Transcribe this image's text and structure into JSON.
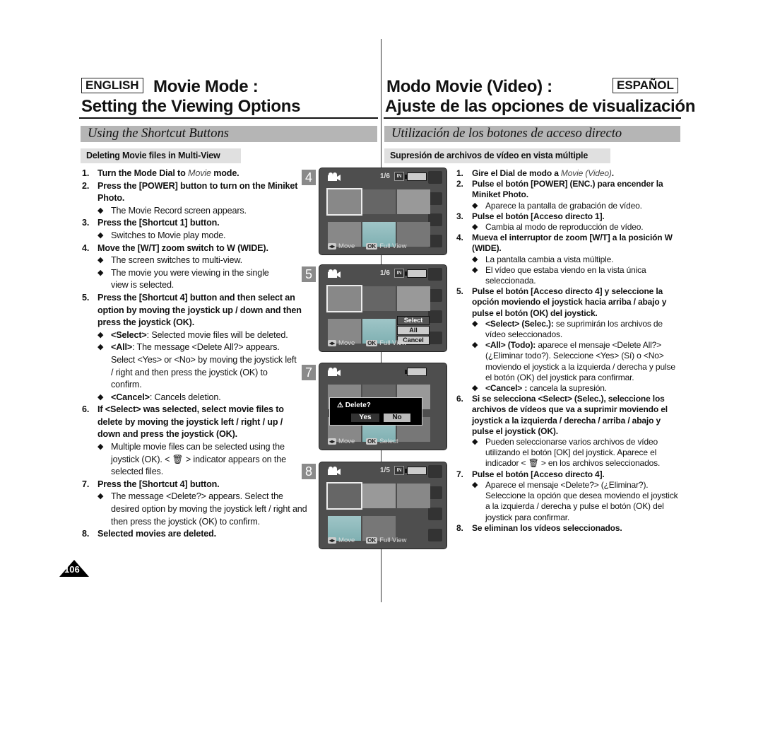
{
  "header": {
    "en_lang": "ENGLISH",
    "en_title_1": "Movie Mode :",
    "en_title_2": "Setting the Viewing Options",
    "es_lang": "ESPAÑOL",
    "es_title_1": "Modo Movie (Video) :",
    "es_title_2": "Ajuste de las opciones de visualización"
  },
  "sections": {
    "en_section": "Using the Shortcut Buttons",
    "es_section": "Utilización de los botones de acceso directo",
    "en_sub": "Deleting Movie files in Multi-View",
    "es_sub": "Supresión de archivos de vídeo en vista múltiple"
  },
  "en_steps": {
    "s1_pre": "Turn the Mode Dial to ",
    "s1_em": "Movie",
    "s1_post": " mode.",
    "s2": "Press the [POWER] button to turn on the Miniket Photo.",
    "s2_b1": "The Movie Record screen appears.",
    "s3": "Press the [Shortcut 1] button.",
    "s3_b1": "Switches to Movie play mode.",
    "s4": "Move the [W/T] zoom switch to W (WIDE).",
    "s4_b1": "The screen switches to multi-view.",
    "s4_b2": "The movie you were viewing in the single view is selected.",
    "s5": "Press the [Shortcut 4] button and then select an option by moving the joystick up / down and then press the joystick (OK).",
    "s5_b1_tag": "<Select>",
    "s5_b1": ": Selected movie files will be deleted.",
    "s5_b2_tag": "<All>",
    "s5_b2": ": The message <Delete All?> appears. Select <Yes> or <No> by moving the joystick left / right and then press the joystick (OK) to confirm.",
    "s5_b3_tag": "<Cancel>",
    "s5_b3": ": Cancels deletion.",
    "s6": "If <Select> was selected, select movie files to delete by moving the joystick left / right / up / down and press the joystick (OK).",
    "s6_b1_pre": "Multiple movie files can be selected using the joystick (OK). < ",
    "s6_b1_post": " > indicator appears on the selected files.",
    "s7": "Press the [Shortcut 4] button.",
    "s7_b1": "The message <Delete?> appears. Select the desired option by moving the joystick left / right and then press the joystick (OK) to confirm.",
    "s8": "Selected movies are deleted."
  },
  "es_steps": {
    "s1_pre": "Gire el Dial de modo a ",
    "s1_em": "Movie (Video)",
    "s1_post": ".",
    "s2": "Pulse el botón [POWER] (ENC.) para encender la Miniket Photo.",
    "s2_b1": "Aparece la pantalla de grabación de vídeo.",
    "s3": "Pulse el botón [Acceso directo 1].",
    "s3_b1": "Cambia al modo de reproducción de vídeo.",
    "s4": "Mueva el interruptor de zoom [W/T] a la posición W (WIDE).",
    "s4_b1": "La pantalla cambia a vista múltiple.",
    "s4_b2": "El vídeo que estaba viendo en la vista única seleccionada.",
    "s5": "Pulse el botón [Acceso directo 4] y seleccione la opción moviendo el joystick hacia arriba / abajo y pulse el botón (OK) del joystick.",
    "s5_b1_tag": "<Select> (Selec.):",
    "s5_b1": " se suprimirán los archivos de vídeo seleccionados.",
    "s5_b2_tag": "<All> (Todo):",
    "s5_b2": " aparece el mensaje <Delete All?> (¿Eliminar todo?). Seleccione <Yes> (Sí) o <No> moviendo el joystick a la izquierda / derecha y pulse el botón (OK) del joystick para confirmar.",
    "s5_b3_tag": "<Cancel> :",
    "s5_b3": " cancela la supresión.",
    "s6": "Si se selecciona <Select> (Selec.), seleccione los archivos de vídeos que va a suprimir moviendo el joystick a la izquierda / derecha / arriba / abajo y pulse el joystick (OK).",
    "s6_b1_pre": "Pueden seleccionarse varios archivos de vídeo utilizando el botón [OK] del joystick. Aparece el indicador < ",
    "s6_b1_post": " > en los archivos seleccionados.",
    "s7": "Pulse el botón [Acceso directo 4].",
    "s7_b1": "Aparece el mensaje <Delete?> (¿Eliminar?). Seleccione la opción que desea moviendo el joystick a la izquierda / derecha y pulse el botón (OK) del joystick para confirmar.",
    "s8": "Se eliminan los vídeos seleccionados."
  },
  "screens": {
    "s4": {
      "num": "4",
      "counter": "1/6",
      "in": "IN",
      "move": "Move",
      "ok": "OK",
      "action": "Full View"
    },
    "s5": {
      "num": "5",
      "counter": "1/6",
      "in": "IN",
      "move": "Move",
      "ok": "OK",
      "action": "Full View",
      "menu": [
        "Select",
        "All",
        "Cancel"
      ]
    },
    "s7": {
      "num": "7",
      "move": "Move",
      "ok": "OK",
      "action": "Select",
      "dialog": "Delete?",
      "yes": "Yes",
      "no": "No"
    },
    "s8": {
      "num": "8",
      "counter": "1/5",
      "in": "IN",
      "move": "Move",
      "ok": "OK",
      "action": "Full View"
    }
  },
  "numbers": [
    "1.",
    "2.",
    "3.",
    "4.",
    "5.",
    "6.",
    "7.",
    "8."
  ],
  "page_number": "106"
}
